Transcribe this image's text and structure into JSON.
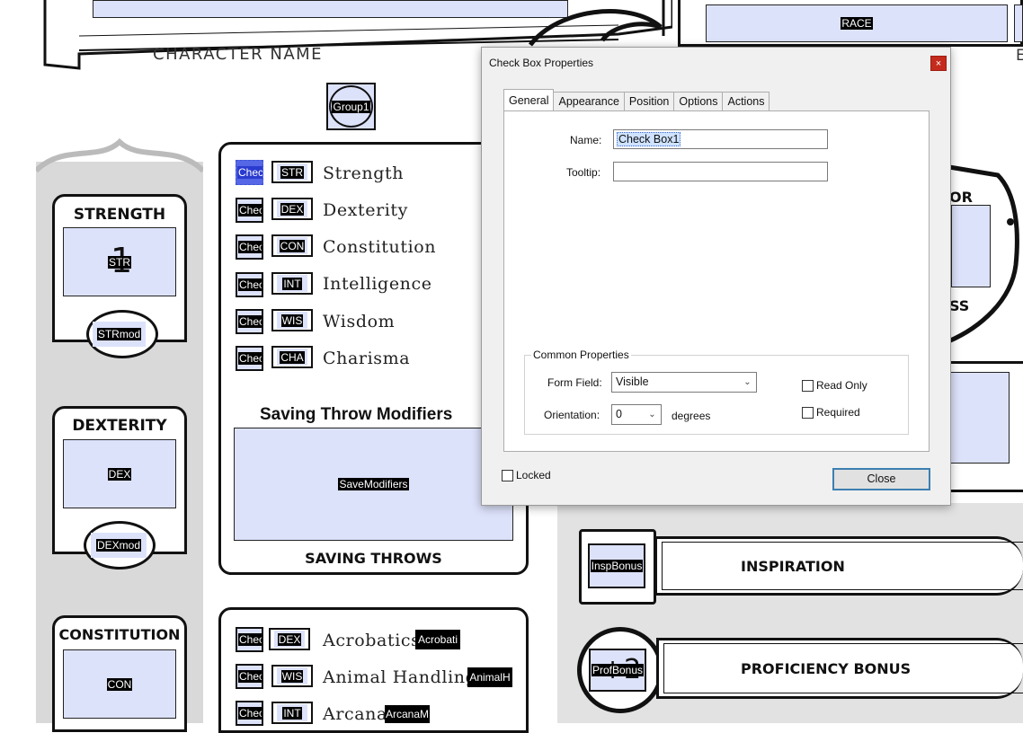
{
  "sheet": {
    "character_name_label": "CHARACTER NAME",
    "race_field": "RACE",
    "group_field": "Group1",
    "abilities": [
      {
        "title": "STRENGTH",
        "field": "STR",
        "mod_field": "STRmod",
        "digit": "1"
      },
      {
        "title": "DEXTERITY",
        "field": "DEX",
        "mod_field": "DEXmod"
      },
      {
        "title": "CONSTITUTION",
        "field": "CON"
      }
    ],
    "saving_throws": [
      {
        "check": "Chec",
        "ability": "STR",
        "label": "Strength"
      },
      {
        "check": "Chec",
        "ability": "DEX",
        "label": "Dexterity"
      },
      {
        "check": "Chec",
        "ability": "CON",
        "label": "Constitution"
      },
      {
        "check": "Chec",
        "ability": "INT",
        "label": "Intelligence"
      },
      {
        "check": "Chec",
        "ability": "WIS",
        "label": "Wisdom"
      },
      {
        "check": "Chec",
        "ability": "CHA",
        "label": "Charisma"
      }
    ],
    "save_modifiers_title": "Saving Throw Modifiers",
    "save_modifiers_field": "SaveModifiers",
    "saving_throws_caption": "SAVING THROWS",
    "skills": [
      {
        "check": "Chec",
        "ability": "DEX",
        "label": "Acrobatics",
        "field": "Acrobati"
      },
      {
        "check": "Chec",
        "ability": "WIS",
        "label": "Animal Handling",
        "field": "AnimalH"
      },
      {
        "check": "Chec",
        "ability": "INT",
        "label": "Arcana",
        "field": "ArcanaM"
      }
    ],
    "right_partial_1": "OR",
    "right_partial_2": "SS",
    "right_partial_3": "E",
    "inspiration_field": "InspBonus",
    "inspiration_label": "INSPIRATION",
    "proficiency_field": "ProfBonus",
    "proficiency_digit": "+2",
    "proficiency_label": "PROFICIENCY BONUS"
  },
  "dialog": {
    "title": "Check Box Properties",
    "close_glyph": "×",
    "tabs": [
      "General",
      "Appearance",
      "Position",
      "Options",
      "Actions"
    ],
    "name_label": "Name:",
    "name_value": "Check Box1",
    "tooltip_label": "Tooltip:",
    "tooltip_value": "",
    "common_title": "Common Properties",
    "form_field_label": "Form Field:",
    "form_field_value": "Visible",
    "orientation_label": "Orientation:",
    "orientation_value": "0",
    "degrees_label": "degrees",
    "read_only_label": "Read Only",
    "required_label": "Required",
    "locked_label": "Locked",
    "close_button": "Close"
  }
}
